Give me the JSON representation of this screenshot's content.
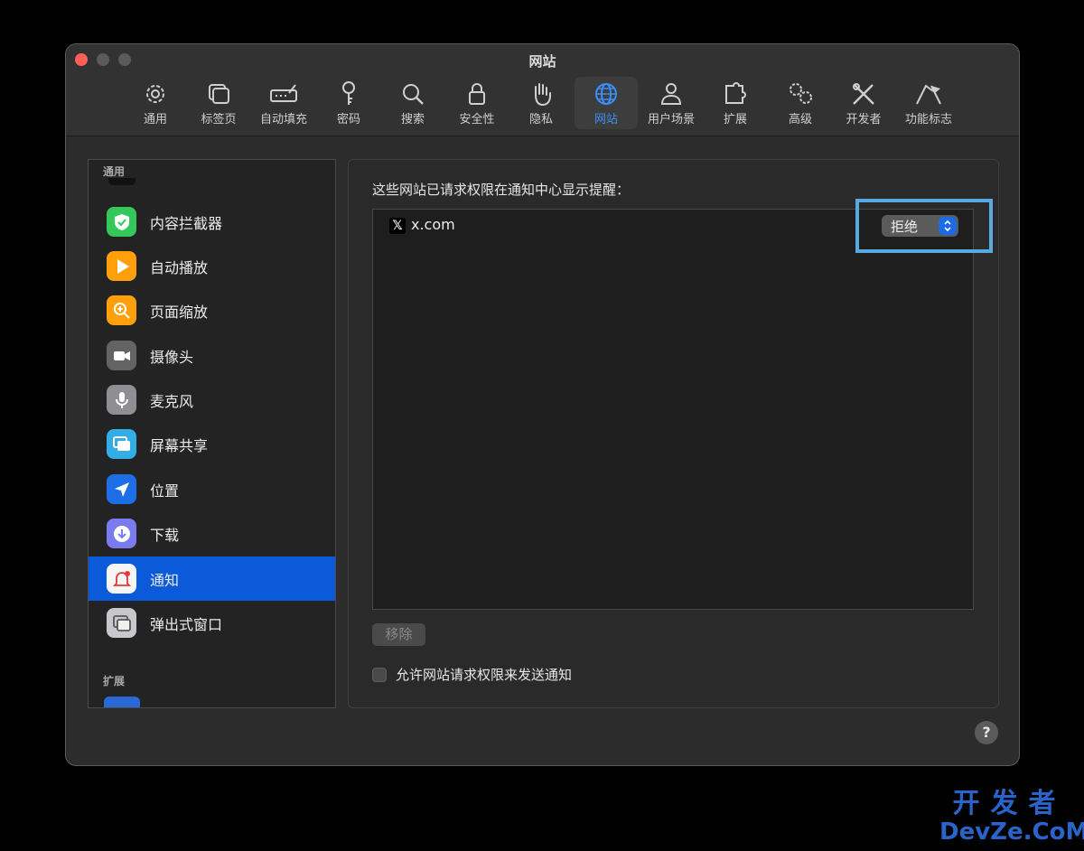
{
  "window": {
    "title": "网站"
  },
  "toolbar": {
    "tabs": [
      {
        "label": "通用",
        "icon": "gear-icon"
      },
      {
        "label": "标签页",
        "icon": "tabs-icon"
      },
      {
        "label": "自动填充",
        "icon": "autofill-icon"
      },
      {
        "label": "密码",
        "icon": "key-icon"
      },
      {
        "label": "搜索",
        "icon": "search-icon"
      },
      {
        "label": "安全性",
        "icon": "lock-icon"
      },
      {
        "label": "隐私",
        "icon": "hand-icon"
      },
      {
        "label": "网站",
        "icon": "globe-icon",
        "active": true
      },
      {
        "label": "用户场景",
        "icon": "person-icon"
      },
      {
        "label": "扩展",
        "icon": "puzzle-icon"
      },
      {
        "label": "高级",
        "icon": "gears-icon"
      },
      {
        "label": "开发者",
        "icon": "tools-icon"
      },
      {
        "label": "功能标志",
        "icon": "flags-icon"
      }
    ]
  },
  "sidebar": {
    "header": "通用",
    "items": [
      {
        "label": "内容拦截器",
        "icon": "shield-check-icon",
        "color": "#34c759"
      },
      {
        "label": "自动播放",
        "icon": "play-icon",
        "color": "#ff9f0a"
      },
      {
        "label": "页面缩放",
        "icon": "zoom-icon",
        "color": "#ff9f0a"
      },
      {
        "label": "摄像头",
        "icon": "camera-icon",
        "color": "#636366"
      },
      {
        "label": "麦克风",
        "icon": "microphone-icon",
        "color": "#8e8e93"
      },
      {
        "label": "屏幕共享",
        "icon": "screen-share-icon",
        "color": "#32ade6"
      },
      {
        "label": "位置",
        "icon": "location-arrow-icon",
        "color": "#1e6ee8"
      },
      {
        "label": "下载",
        "icon": "download-icon",
        "color": "#7b7bf0"
      },
      {
        "label": "通知",
        "icon": "bell-icon",
        "color": "#f5f5f5",
        "active": true
      },
      {
        "label": "弹出式窗口",
        "icon": "popup-window-icon",
        "color": "#c7c7cc"
      }
    ],
    "section2": "扩展"
  },
  "content": {
    "heading": "这些网站已请求权限在通知中心显示提醒：",
    "rows": [
      {
        "site": "x.com",
        "permission": "拒绝",
        "icon": "x-logo-icon"
      }
    ],
    "remove_label": "移除",
    "allow_label": "允许网站请求权限来发送通知",
    "help_label": "?"
  },
  "watermark": {
    "line1": "开发者",
    "line2": "DevZe.CoM"
  }
}
